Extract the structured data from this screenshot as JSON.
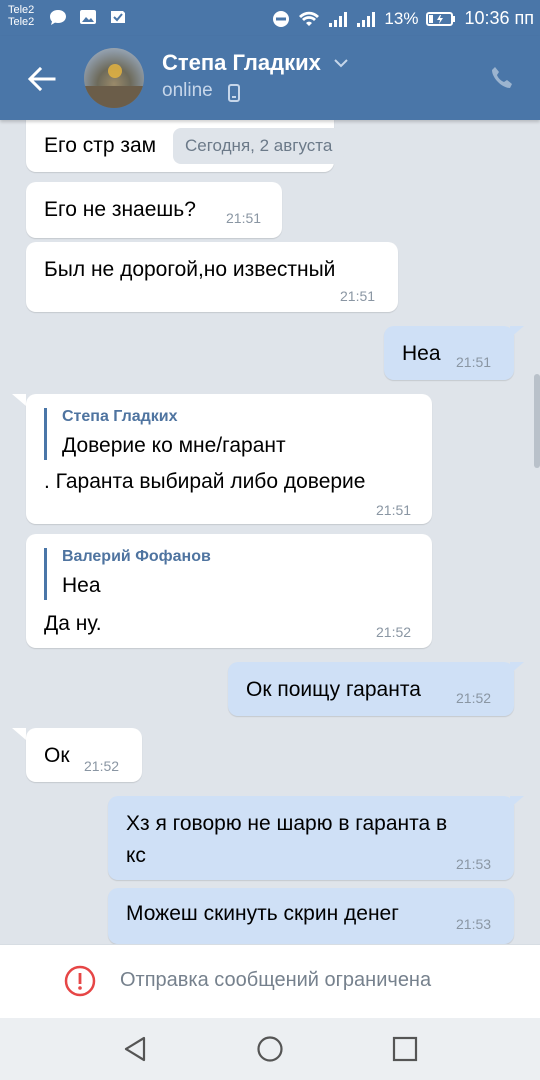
{
  "status_bar": {
    "carrier_1": "Tele2",
    "carrier_2": "Tele2",
    "battery": "13%",
    "time": "10:36 пп"
  },
  "header": {
    "contact_name": "Степа Гладких",
    "status": "online"
  },
  "chat": {
    "date_separator": "Сегодня, 2 августа",
    "messages": [
      {
        "direction": "in",
        "text": "Его стр зам",
        "time": ""
      },
      {
        "direction": "in",
        "text": "Его не знаешь?",
        "time": "21:51"
      },
      {
        "direction": "in",
        "text": "Был не дорогой,но известный",
        "time": "21:51"
      },
      {
        "direction": "out",
        "text": "Неа",
        "time": "21:51"
      },
      {
        "direction": "in",
        "quote_author": "Степа Гладких",
        "quote_text": "Доверие ко мне/гарант",
        "text": ". Гаранта выбирай либо доверие",
        "time": "21:51"
      },
      {
        "direction": "in",
        "quote_author": "Валерий Фофанов",
        "quote_text": "Неа",
        "text": "Да ну.",
        "time": "21:52"
      },
      {
        "direction": "out",
        "text": "Ок поищу гаранта",
        "time": "21:52"
      },
      {
        "direction": "in",
        "text": "Ок",
        "time": "21:52"
      },
      {
        "direction": "out",
        "text_line1": "Хз я говорю не шарю в гаранта в",
        "text_line2": "кс",
        "time": "21:53"
      },
      {
        "direction": "out",
        "text": "Можеш скинуть скрин денег",
        "time": "21:53"
      }
    ]
  },
  "footer": {
    "restricted_text": "Отправка сообщений ограничена"
  },
  "icons": {
    "back": "arrow-left-icon",
    "call": "phone-icon",
    "warning": "exclamation-circle-icon",
    "nav_back": "triangle-back-icon",
    "nav_home": "circle-home-icon",
    "nav_recents": "square-recents-icon"
  },
  "colors": {
    "header": "#4a76a8",
    "chat_background": "#dfe4ea",
    "incoming_bubble": "#ffffff",
    "outgoing_bubble": "#cfe0f6",
    "warning": "#e64646"
  }
}
